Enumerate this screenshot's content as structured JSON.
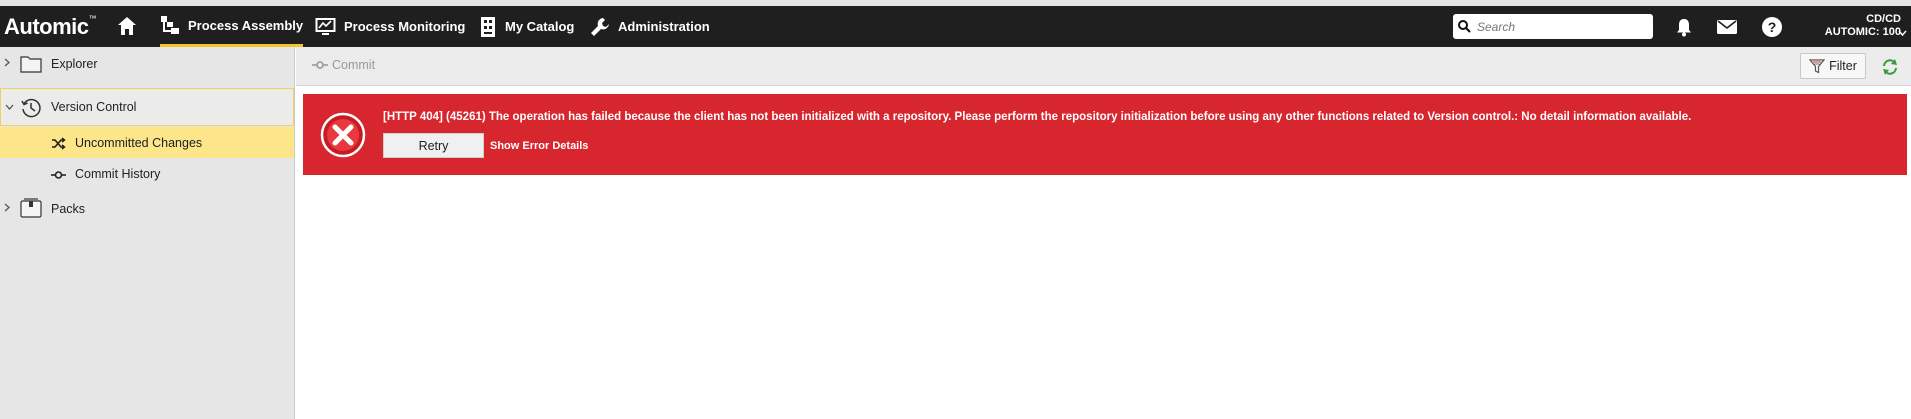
{
  "app": {
    "logo": "Automic",
    "logo_mark": "™"
  },
  "nav": {
    "items": [
      {
        "label": "Process Assembly",
        "active": true
      },
      {
        "label": "Process Monitoring",
        "active": false
      },
      {
        "label": "My Catalog",
        "active": false
      },
      {
        "label": "Administration",
        "active": false
      }
    ],
    "search_placeholder": "Search",
    "client_line1": "CD/CD",
    "client_line2": "AUTOMIC: 100"
  },
  "sidebar": {
    "items": [
      {
        "label": "Explorer"
      },
      {
        "label": "Version Control"
      },
      {
        "label": "Uncommitted Changes"
      },
      {
        "label": "Commit History"
      },
      {
        "label": "Packs"
      }
    ]
  },
  "toolbar": {
    "commit_label": "Commit",
    "filter_label": "Filter"
  },
  "error": {
    "message": "[HTTP 404] (45261) The operation has failed because the client has not been initialized with a repository. Please perform the repository initialization before using any other functions related to Version control.: No detail information available.",
    "retry_label": "Retry",
    "details_label": "Show Error Details"
  },
  "colors": {
    "accent": "#f4c430",
    "error": "#d7262e",
    "selected": "#fde58a",
    "navbar": "#1f1f1f"
  }
}
